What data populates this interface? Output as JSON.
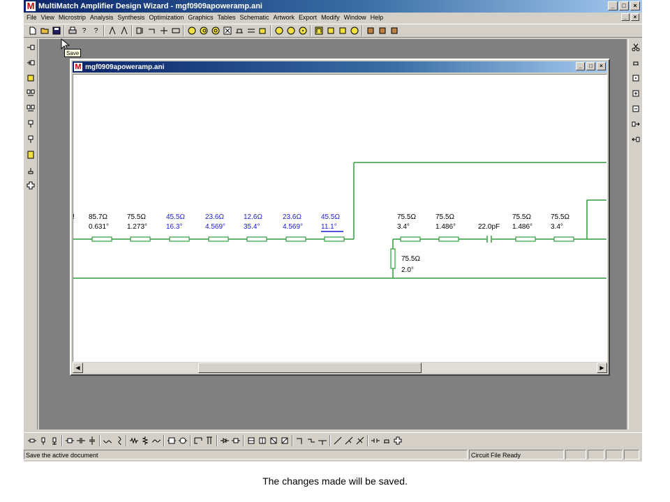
{
  "app": {
    "title": "MultiMatch Amplifier Design Wizard - mgf0909apoweramp.ani",
    "logo_letter": "M",
    "window_buttons": [
      "_",
      "□",
      "×"
    ],
    "mdi_buttons": [
      "_",
      "×"
    ]
  },
  "menu": [
    "File",
    "View",
    "Microstrip",
    "Analysis",
    "Synthesis",
    "Optimization",
    "Graphics",
    "Tables",
    "Schematic",
    "Artwork",
    "Export",
    "Modify",
    "Window",
    "Help"
  ],
  "tooltip": "Save",
  "child_window": {
    "title": "mgf0909apoweramp.ani",
    "buttons": [
      "_",
      "□",
      "×"
    ]
  },
  "schematic": {
    "line_color": "#2e9e3a",
    "label_color_black": "#000000",
    "label_color_blue": "#1a1ad6",
    "top_elements": [
      {
        "impedance": "85.7Ω",
        "length": "0.631°",
        "color": "black"
      },
      {
        "impedance": "75.5Ω",
        "length": "1.273°",
        "color": "black"
      },
      {
        "impedance": "45.5Ω",
        "length": "16.3°",
        "color": "blue"
      },
      {
        "impedance": "23.6Ω",
        "length": "4.569°",
        "color": "blue"
      },
      {
        "impedance": "12.6Ω",
        "length": "35.4°",
        "color": "blue"
      },
      {
        "impedance": "23.6Ω",
        "length": "4.569°",
        "color": "blue"
      },
      {
        "impedance": "45.5Ω",
        "length": "11.1°",
        "color": "blue"
      },
      {
        "impedance": "75.5Ω",
        "length": "3.4°",
        "color": "black"
      },
      {
        "impedance": "75.5Ω",
        "length": "1.486°",
        "color": "black"
      },
      {
        "impedance": "22.0pF",
        "length": "",
        "color": "black"
      },
      {
        "impedance": "75.5Ω",
        "length": "1.486°",
        "color": "black"
      },
      {
        "impedance": "75.5Ω",
        "length": "3.4°",
        "color": "black"
      }
    ],
    "shunt_stub": {
      "impedance": "75.5Ω",
      "length": "2.0°"
    }
  },
  "status": {
    "message": "Save the active document",
    "state": "Circuit File Ready"
  },
  "caption": "The changes made will be saved."
}
